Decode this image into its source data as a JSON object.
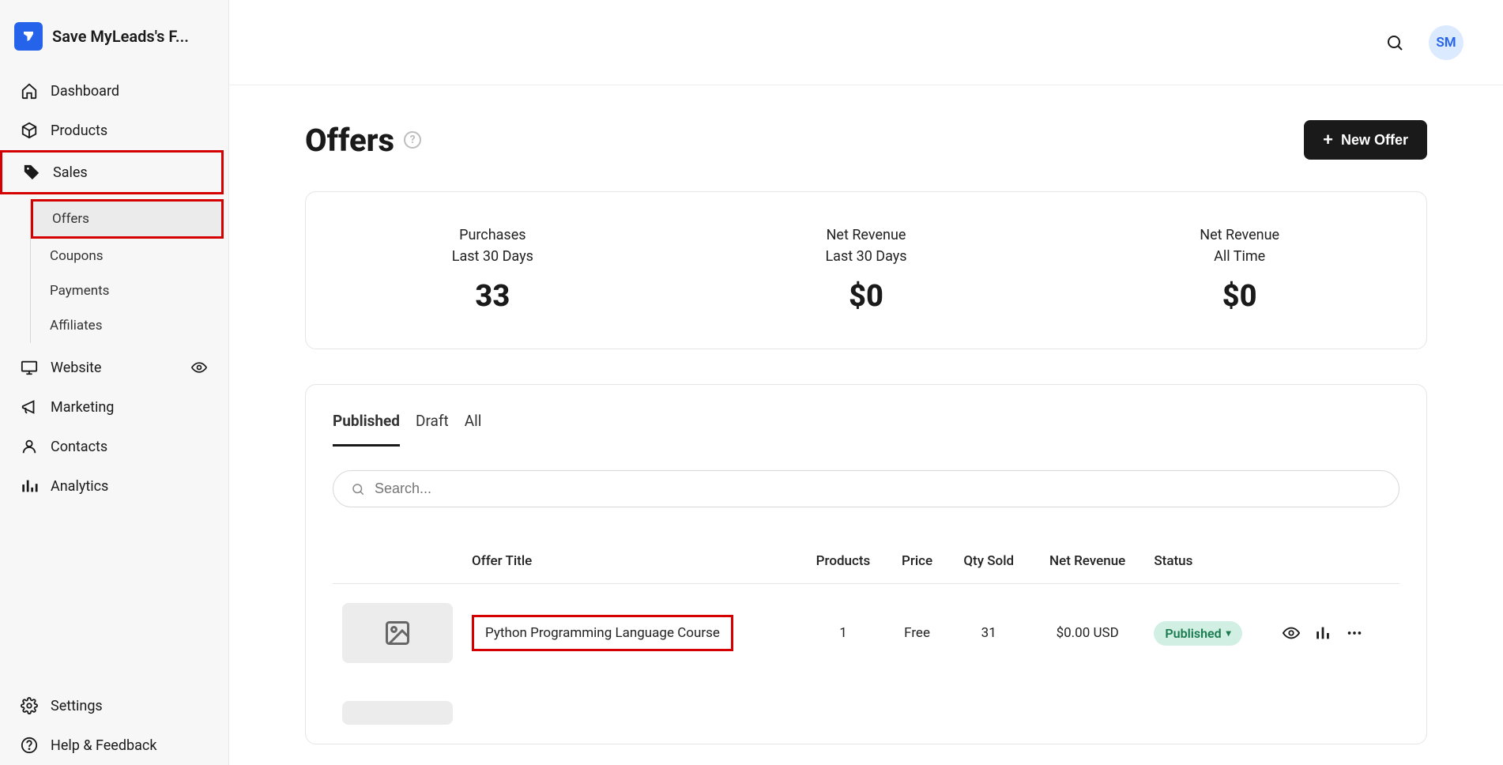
{
  "org_name": "Save MyLeads's F...",
  "avatar_initials": "SM",
  "sidebar": {
    "dashboard": "Dashboard",
    "products": "Products",
    "sales": "Sales",
    "offers": "Offers",
    "coupons": "Coupons",
    "payments": "Payments",
    "affiliates": "Affiliates",
    "website": "Website",
    "marketing": "Marketing",
    "contacts": "Contacts",
    "analytics": "Analytics",
    "settings": "Settings",
    "help": "Help & Feedback"
  },
  "page": {
    "title": "Offers",
    "new_offer_btn": "New Offer"
  },
  "stats": [
    {
      "label": "Purchases",
      "sub": "Last 30 Days",
      "value": "33"
    },
    {
      "label": "Net Revenue",
      "sub": "Last 30 Days",
      "value": "$0"
    },
    {
      "label": "Net Revenue",
      "sub": "All Time",
      "value": "$0"
    }
  ],
  "tabs": {
    "published": "Published",
    "draft": "Draft",
    "all": "All"
  },
  "search_placeholder": "Search...",
  "table": {
    "headers": {
      "title": "Offer Title",
      "products": "Products",
      "price": "Price",
      "qty": "Qty Sold",
      "revenue": "Net Revenue",
      "status": "Status"
    },
    "rows": [
      {
        "title": "Python Programming Language Course",
        "products": "1",
        "price": "Free",
        "qty": "31",
        "revenue": "$0.00 USD",
        "status": "Published"
      }
    ]
  }
}
